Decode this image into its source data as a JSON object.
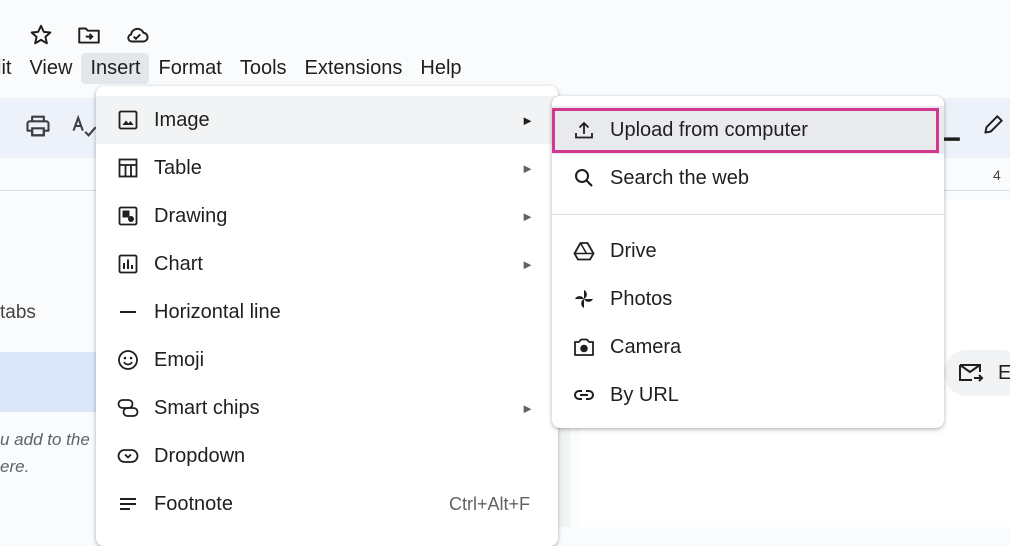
{
  "menubar": {
    "items": [
      {
        "label": "lit"
      },
      {
        "label": "View"
      },
      {
        "label": "Insert"
      },
      {
        "label": "Format"
      },
      {
        "label": "Tools"
      },
      {
        "label": "Extensions"
      },
      {
        "label": "Help"
      }
    ]
  },
  "ruler": {
    "number": "4"
  },
  "left_panel": {
    "tabs_text": "tabs",
    "note_line1": "u add to the",
    "note_line2": "ere."
  },
  "email_chip": {
    "label": "E"
  },
  "insert_menu": {
    "items": [
      {
        "label": "Image",
        "icon": "image-icon"
      },
      {
        "label": "Table",
        "icon": "table-icon"
      },
      {
        "label": "Drawing",
        "icon": "drawing-icon"
      },
      {
        "label": "Chart",
        "icon": "chart-icon"
      },
      {
        "label": "Horizontal line",
        "icon": "horizontal-line-icon"
      },
      {
        "label": "Emoji",
        "icon": "emoji-icon"
      },
      {
        "label": "Smart chips",
        "icon": "smart-chips-icon"
      },
      {
        "label": "Dropdown",
        "icon": "dropdown-icon"
      },
      {
        "label": "Footnote",
        "icon": "footnote-icon",
        "shortcut": "Ctrl+Alt+F"
      }
    ],
    "submenu_arrow": "►"
  },
  "image_submenu": {
    "items": [
      {
        "label": "Upload from computer",
        "icon": "upload-icon"
      },
      {
        "label": "Search the web",
        "icon": "search-icon"
      },
      {
        "label": "Drive",
        "icon": "drive-icon"
      },
      {
        "label": "Photos",
        "icon": "photos-icon"
      },
      {
        "label": "Camera",
        "icon": "camera-icon"
      },
      {
        "label": "By URL",
        "icon": "link-icon"
      }
    ]
  },
  "colors": {
    "highlight": "#d0378d",
    "toolbar_bg": "#edf2fa"
  }
}
